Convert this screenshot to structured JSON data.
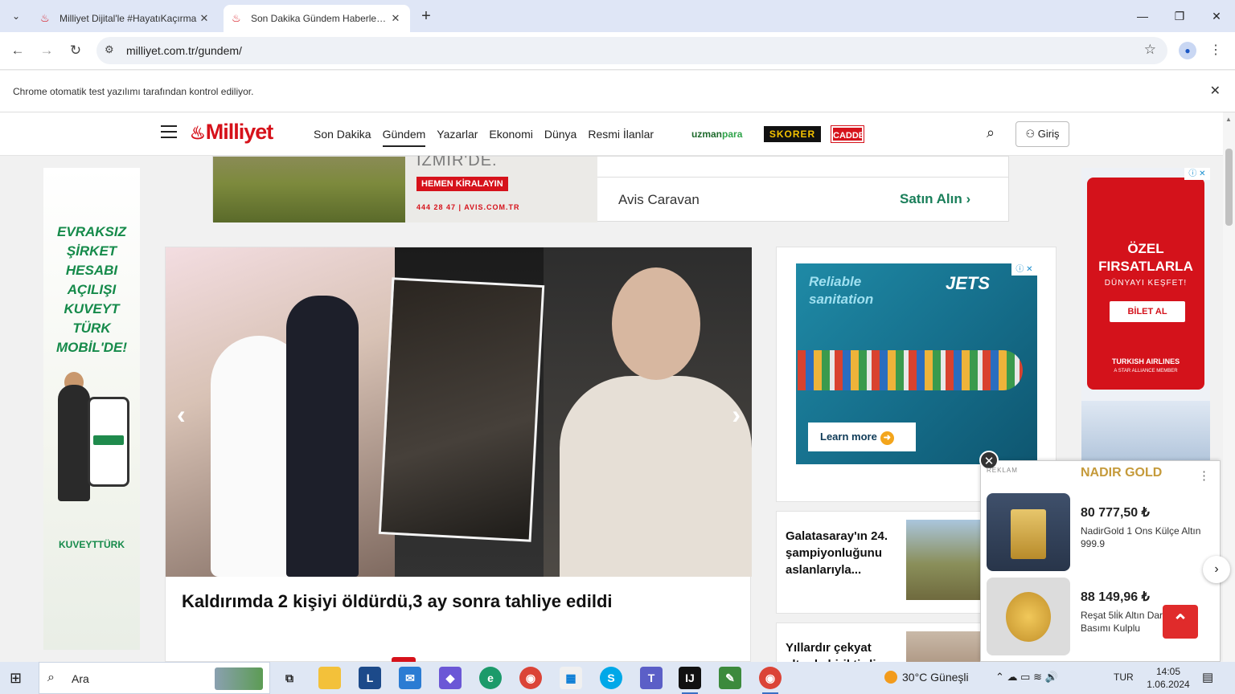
{
  "browser": {
    "tabs": [
      {
        "title": "Milliyet Dijital'le #HayatıKaçırma",
        "active": false
      },
      {
        "title": "Son Dakika Gündem Haberleri - Milliyet",
        "active": true
      }
    ],
    "url": "milliyet.com.tr/gundem/",
    "infobar_message": "Chrome otomatik test yazılımı tarafından kontrol ediliyor."
  },
  "site": {
    "logo_text": "Milliyet",
    "nav": [
      "Son Dakika",
      "Gündem",
      "Yazarlar",
      "Ekonomi",
      "Dünya",
      "Resmi İlanlar"
    ],
    "active_nav": "Gündem",
    "partners": {
      "uzman_a": "uzman",
      "uzman_b": "para",
      "skorer": "SKORER",
      "cadde": "CADDE"
    },
    "login_label": "Giriş"
  },
  "top_ad": {
    "city_text": "İZMİR'DE.",
    "cta": "HEMEN KİRALAYIN",
    "contact": "444 28 47  |  AVIS.COM.TR",
    "brand": "Avis Caravan",
    "buy_label": "Satın Alın"
  },
  "left_ad": {
    "headline": "EVRAKSIZ ŞİRKET HESABI AÇILIŞI KUVEYT TÜRK MOBİL'DE!",
    "brand": "KUVEYTTÜRK"
  },
  "right_ad": {
    "headline": "ÖZEL FIRSATLARLA",
    "sub": "DÜNYAYI KEŞFET!",
    "button": "BİLET AL",
    "airline": "TURKISH AIRLINES",
    "member": "A STAR ALLIANCE MEMBER"
  },
  "slider": {
    "caption": "Kaldırımda 2 kişiyi öldürdü,3 ay sonra tahliye edildi"
  },
  "jets_ad": {
    "tagline": "Reliable sanitation",
    "brand": "JETS",
    "button": "Learn more"
  },
  "news_cards": [
    {
      "title": "Galatasaray'ın 24. şampiyonluğunu aslanlarıyla..."
    },
    {
      "title": "Yıllardır çekyat altında biriktirdi..."
    }
  ],
  "popup_ad": {
    "label": "REKLAM",
    "brand": "NADIR GOLD",
    "products": [
      {
        "price": "80 777,50 ₺",
        "name": "NadirGold 1 Ons Külçe Altın 999.9"
      },
      {
        "price": "88 149,96 ₺",
        "name": "Reşat 5li̇k Altın Darphane Basımı Kulplu"
      }
    ]
  },
  "taskbar": {
    "search_label": "Ara",
    "weather": "30°C  Güneşli",
    "language": "TUR",
    "time": "14:05",
    "date": "1.06.2024"
  },
  "colors": {
    "brand_red": "#d6121b",
    "chrome_tab_bg": "#dfe6f6",
    "taskbar_bg": "#dfe7f4"
  }
}
